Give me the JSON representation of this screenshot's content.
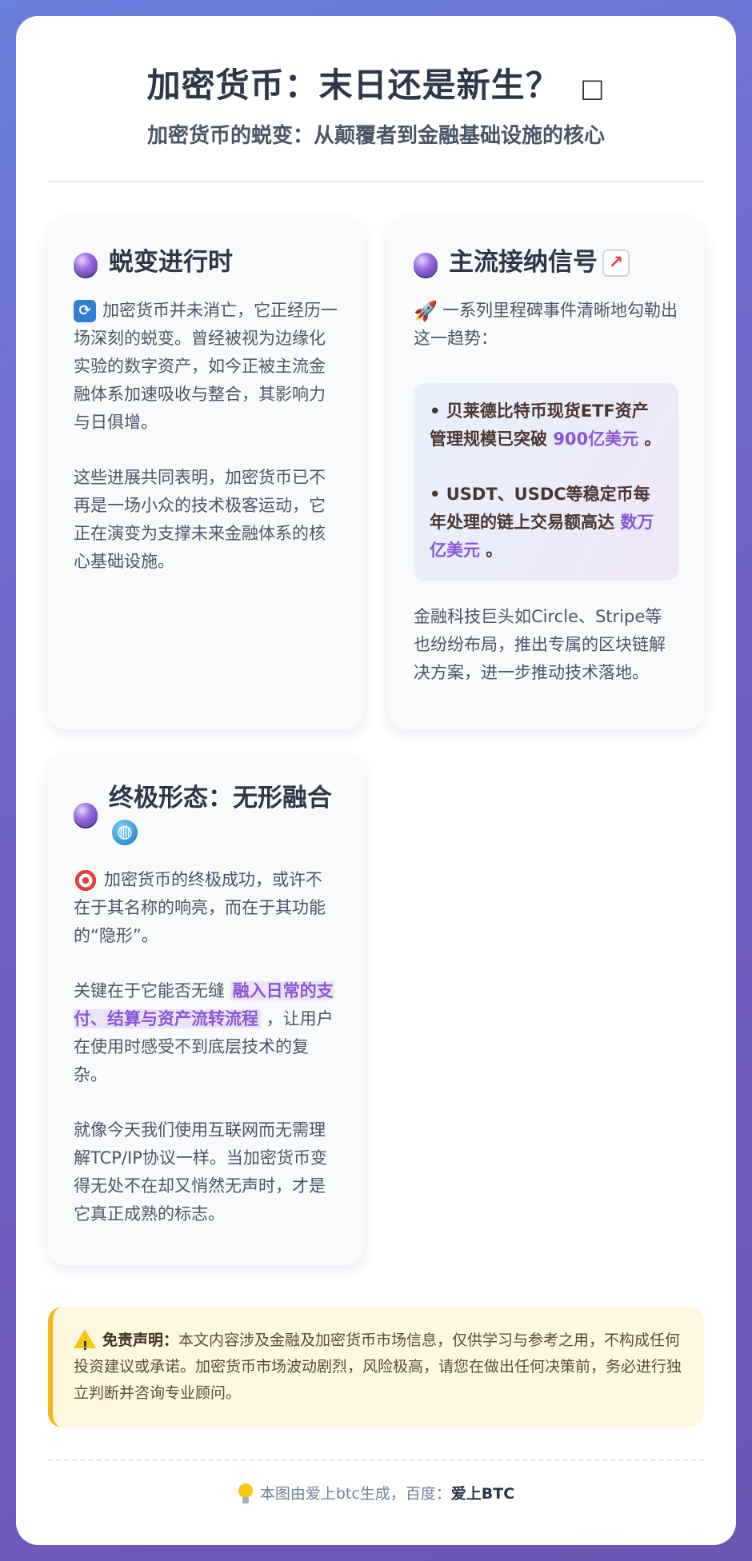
{
  "header": {
    "title": "加密货币：末日还是新生？",
    "title_icon": "□",
    "subtitle": "加密货币的蜕变：从颠覆者到金融基础设施的核心"
  },
  "cards": [
    {
      "title": "蜕变进行时",
      "icon": "crystal-ball-icon",
      "lead_icon": "refresh-icon",
      "p1": "加密货币并未消亡，它正经历一场深刻的蜕变。曾经被视为边缘化实验的数字资产，如今正被主流金融体系加速吸收与整合，其影响力与日俱增。",
      "p2": "这些进展共同表明，加密货币已不再是一场小众的技术极客运动，它正在演变为支撑未来金融体系的核心基础设施。"
    },
    {
      "title": "主流接纳信号",
      "icon": "crystal-ball-icon",
      "title_icon": "chart-increasing-icon",
      "lead_icon": "rocket-icon",
      "p1": "一系列里程碑事件清晰地勾勒出这一趋势：",
      "highlights": [
        {
          "prefix": "• 贝莱德比特币现货ETF资产管理规模已突破 ",
          "value": "900亿美元",
          "suffix": " 。"
        },
        {
          "prefix": "• USDT、USDC等稳定币每年处理的链上交易额高达 ",
          "value": "数万亿美元",
          "suffix": " 。"
        }
      ],
      "p2": "金融科技巨头如Circle、Stripe等也纷纷布局，推出专属的区块链解决方案，进一步推动技术落地。"
    },
    {
      "title": "终极形态：无形融合",
      "icon": "crystal-ball-icon",
      "title_icon": "globe-icon",
      "lead_icon": "target-icon",
      "p1": "加密货币的终极成功，或许不在于其名称的响亮，而在于其功能的“隐形”。",
      "p2_prefix": "关键在于它能否无缝 ",
      "p2_mark": "融入日常的支付、结算与资产流转流程",
      "p2_suffix": " ，让用户在使用时感受不到底层技术的复杂。",
      "p3": "就像今天我们使用互联网而无需理解TCP/IP协议一样。当加密货币变得无处不在却又悄然无声时，才是它真正成熟的标志。"
    }
  ],
  "disclaimer": {
    "label": "免责声明：",
    "text": "本文内容涉及金融及加密货币市场信息，仅供学习与参考之用，不构成任何投资建议或承诺。加密货币市场波动剧烈，风险极高，请您在做出任何决策前，务必进行独立判断并咨询专业顾问。"
  },
  "footer": {
    "text": "本图由爱上btc生成，百度：",
    "brand": "爱上BTC"
  },
  "colors": {
    "accent": "#8a55d6",
    "warning_border": "#f6b61a",
    "title": "#2d3748"
  }
}
